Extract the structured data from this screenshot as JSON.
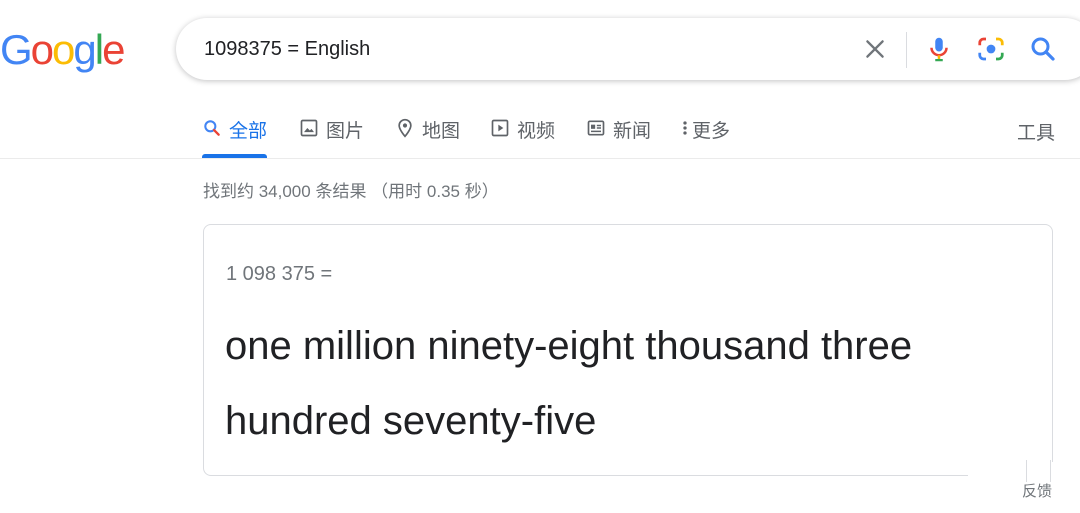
{
  "logo": {
    "letters": [
      "G",
      "o",
      "o",
      "g",
      "l",
      "e"
    ],
    "colors": [
      "#4285F4",
      "#EA4335",
      "#FBBC05",
      "#4285F4",
      "#34A853",
      "#EA4335"
    ]
  },
  "search": {
    "query": "1098375 = English"
  },
  "tabs": [
    {
      "label": "全部",
      "icon": "search-icon",
      "active": true
    },
    {
      "label": "图片",
      "icon": "image-icon",
      "active": false
    },
    {
      "label": "地图",
      "icon": "map-pin-icon",
      "active": false
    },
    {
      "label": "视频",
      "icon": "play-icon",
      "active": false
    },
    {
      "label": "新闻",
      "icon": "news-icon",
      "active": false
    },
    {
      "label": "更多",
      "icon": "more-vertical-icon",
      "active": false
    }
  ],
  "tools_label": "工具",
  "result_stats": "找到约 34,000 条结果 （用时 0.35 秒）",
  "answer": {
    "equation": "1 098 375 =",
    "words": "one million ninety-eight thousand three hundred seventy-five"
  },
  "feedback_label": "反馈",
  "colors": {
    "accent": "#1a73e8",
    "muted": "#70757a"
  }
}
